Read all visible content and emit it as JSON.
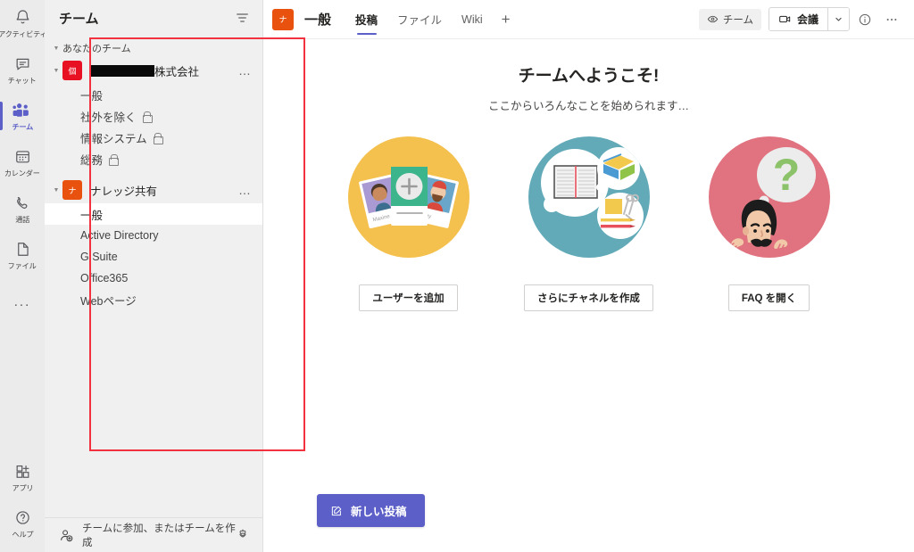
{
  "rail": {
    "items": [
      {
        "label": "アクティビティ",
        "icon": "bell-icon",
        "active": false
      },
      {
        "label": "チャット",
        "icon": "chat-icon",
        "active": false
      },
      {
        "label": "チーム",
        "icon": "teams-icon",
        "active": true
      },
      {
        "label": "カレンダー",
        "icon": "calendar-icon",
        "active": false
      },
      {
        "label": "通話",
        "icon": "phone-icon",
        "active": false
      },
      {
        "label": "ファイル",
        "icon": "file-icon",
        "active": false
      }
    ],
    "more_label": "...",
    "bottom": [
      {
        "label": "アプリ",
        "icon": "apps-icon"
      },
      {
        "label": "ヘルプ",
        "icon": "help-icon"
      }
    ]
  },
  "panel": {
    "title": "チーム",
    "filter_icon": "filter-icon",
    "group_label": "あなたのチーム",
    "teams": [
      {
        "avatar_letter": "個",
        "avatar_color": "#e81123",
        "name_redacted": true,
        "name_suffix": "株式会社",
        "more_label": "…",
        "channels": [
          {
            "name": "一般",
            "private": false,
            "selected": false
          },
          {
            "name": "社外を除く",
            "private": true,
            "selected": false
          },
          {
            "name": "情報システム",
            "private": true,
            "selected": false
          },
          {
            "name": "総務",
            "private": true,
            "selected": false
          }
        ]
      },
      {
        "avatar_letter": "ナ",
        "avatar_color": "#e8520e",
        "name_redacted": false,
        "name": "ナレッジ共有",
        "more_label": "…",
        "channels": [
          {
            "name": "一般",
            "private": false,
            "selected": true
          },
          {
            "name": "Active Directory",
            "private": false,
            "selected": false
          },
          {
            "name": "G Suite",
            "private": false,
            "selected": false
          },
          {
            "name": "Office365",
            "private": false,
            "selected": false
          },
          {
            "name": "Webページ",
            "private": false,
            "selected": false
          }
        ]
      }
    ],
    "footer": {
      "label": "チームに参加、またはチームを作成",
      "icon": "add-team-icon",
      "settings_icon": "gear-icon"
    }
  },
  "topbar": {
    "channel_avatar_letter": "ナ",
    "channel_avatar_color": "#e8520e",
    "channel_title": "一般",
    "tabs": [
      {
        "label": "投稿",
        "active": true
      },
      {
        "label": "ファイル",
        "active": false
      },
      {
        "label": "Wiki",
        "active": false
      }
    ],
    "add_tab_label": "+",
    "team_pill_label": "チーム",
    "team_pill_icon": "eye-icon",
    "meet_label": "会議",
    "meet_icon": "video-icon",
    "meet_caret": "⌄",
    "info_icon": "info-icon",
    "more_icon": "more-icon"
  },
  "welcome": {
    "title": "チームへようこそ!",
    "subtitle": "ここからいろんなことを始められます…",
    "cards": [
      {
        "id": "add-users",
        "button": "ユーザーを追加",
        "circle_color": "#f4c04e",
        "illustration": "people-cards-illustration"
      },
      {
        "id": "create-channels",
        "button": "さらにチャネルを作成",
        "circle_color": "#62aab8",
        "illustration": "notebook-supplies-illustration"
      },
      {
        "id": "open-faq",
        "button": "FAQ を開く",
        "circle_color": "#e0737f",
        "illustration": "question-person-illustration"
      }
    ]
  },
  "compose": {
    "new_post_label": "新しい投稿",
    "new_post_icon": "compose-icon",
    "accent_color": "#5b5fc7"
  },
  "annotation": {
    "color": "#f2323f"
  }
}
